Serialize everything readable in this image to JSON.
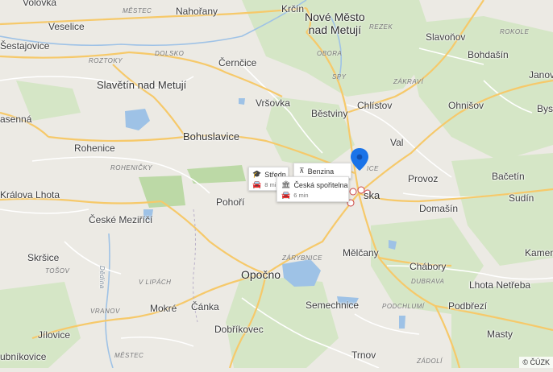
{
  "map": {
    "labels": {
      "volovka": "Volovka",
      "mestec_top": "MĚSTEC",
      "nahorany": "Nahořany",
      "krcin": "Krčín",
      "nove_mesto": "Nové Město\nnad Metují",
      "veselice": "Veselice",
      "rezek": "REZEK",
      "slavonov": "Slavoňov",
      "sestajovice": "Šestajovice",
      "roztoky": "ROZTOKY",
      "dolsko": "DOLSKO",
      "obora": "OBORA",
      "rokole": "ROKOLE",
      "bohdasin": "Bohdašín",
      "cernice": "Černčice",
      "spy": "SPY",
      "janov": "Janov",
      "zakravi": "ZÁKRAVÍ",
      "slavetin": "Slavětín nad Metují",
      "vrsovka": "Vršovka",
      "chlistov": "Chlístov",
      "ohnisov": "Ohnišov",
      "byst": "Byst",
      "asenna": "asenná",
      "bestviny": "Běstviny",
      "bohuslavice": "Bohuslavice",
      "rohenice": "Rohenice",
      "val": "Val",
      "rohenicky": "ROHENIČKY",
      "provoz": "Provoz",
      "bacetin": "Bačetín",
      "kralova_lhota": "Králova Lhota",
      "pohori": "Pohoří",
      "sudin": "Sudín",
      "ceske_mezirici": "České Meziříčí",
      "domasin": "Domašín",
      "skrsice": "Skršice",
      "tosov": "TOŠOV",
      "melcany": "Mělčany",
      "kamen": "Kamen",
      "zarybnice": "ZÁRYBNICE",
      "dedina": "Dědina",
      "opocno": "Opočno",
      "chabory": "Chábory",
      "v_lipach": "V LIPÁCH",
      "dubrava": "DUBRAVA",
      "lhota_netreba": "Lhota Netřeba",
      "vranov": "VRANOV",
      "mokre": "Mokré",
      "canka": "Čánka",
      "semechnice": "Semechnice",
      "podchlumi": "PODCHLUMÍ",
      "podbrezi": "Podbřezí",
      "jilovice": "Jílovice",
      "dobrikovec": "Dobříkovec",
      "masty": "Masty",
      "ubnikovice": "ubníkovice",
      "mestec_bottom": "MĚSTEC",
      "trnov": "Trnov",
      "zadoli": "ZÁDOLÍ",
      "ceska": "ska",
      "ice": "ICE"
    },
    "popups": {
      "stredni": {
        "title": "Středn",
        "time": "8 mi"
      },
      "benzina": {
        "title": "Benzina"
      },
      "sporitelna": {
        "title": "Česká spořitelna",
        "time": "6 min"
      }
    },
    "copyright": "© ČÚZK",
    "colors": {
      "background": "#eceae4",
      "forest": "#cfe3c0",
      "water": "#9ec2e6",
      "road_major": "#f6c96a",
      "road_minor": "#ffffff",
      "pin": "#1a73e8"
    }
  }
}
